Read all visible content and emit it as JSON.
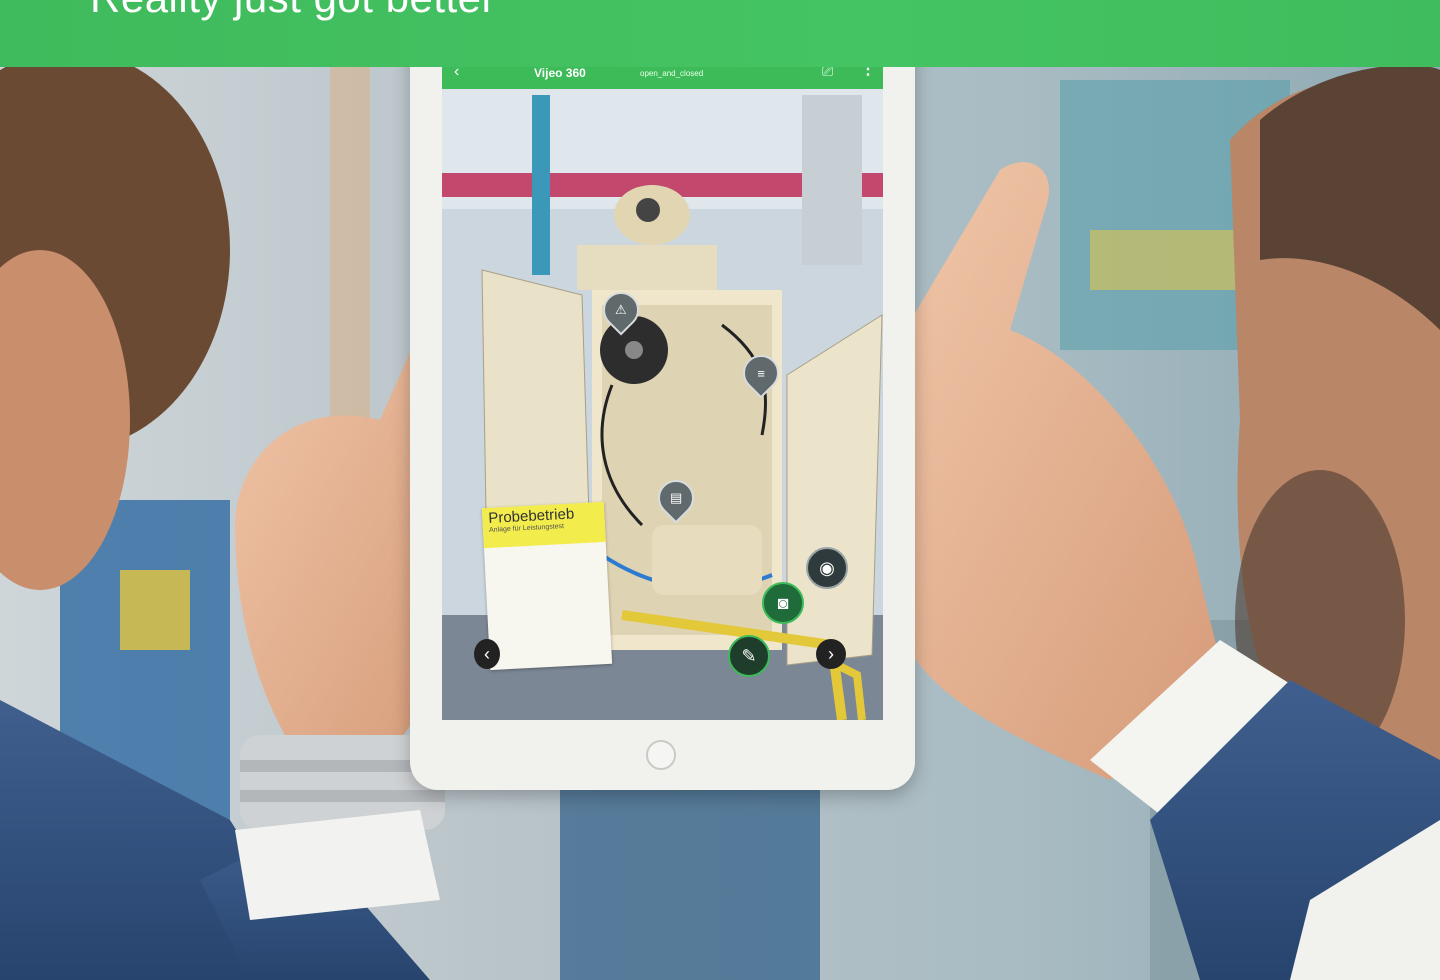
{
  "banner": {
    "title": "Reality just got better"
  },
  "app": {
    "title": "Vijeo 360",
    "subtitle": "open_and_closed",
    "back_icon": "chevron-left-icon",
    "menu_icon": "more-vertical-icon",
    "cast_icon": "cast-icon"
  },
  "label_card": {
    "title": "Probebetrieb",
    "subtitle": "Anlage für Leistungstest"
  },
  "colors": {
    "brand_green": "#3dbb59",
    "banner_green": "#45c463",
    "fab_dark": "#2f3a3c",
    "fab_green": "#1f6b3a"
  },
  "ar_buttons": [
    "eye-icon",
    "camera-icon",
    "pencil-icon",
    "chevron-right-icon",
    "chevron-left-icon"
  ],
  "ar_pins": [
    "warning-icon",
    "list-icon",
    "document-icon"
  ]
}
